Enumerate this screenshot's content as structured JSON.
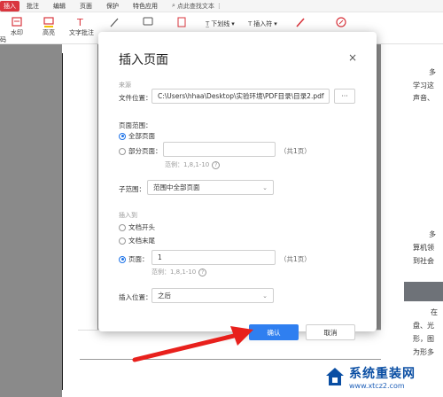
{
  "menubar": {
    "tabs": [
      "插入",
      "批注",
      "编辑",
      "页面",
      "保护",
      "特色应用"
    ],
    "search_label": "点此查找文本"
  },
  "ribbon": {
    "items": [
      "水印",
      "高亮",
      "文字批注",
      "下划线",
      "插入符"
    ],
    "left_partial": "码"
  },
  "dialog": {
    "title": "插入页面",
    "source_section": "来源",
    "file_location_label": "文件位置：",
    "file_path": "C:\\Users\\hhaa\\Desktop\\实验环境\\PDF目录\\目录2.pdf",
    "browse_label": "···",
    "page_range_section": "页面范围：",
    "all_pages_label": "全部页面",
    "partial_pages_label": "部分页面：",
    "partial_pages_value": "",
    "partial_total": "（共1页）",
    "partial_example": "范例：1,8,1-10",
    "sub_range_label": "子范围：",
    "sub_range_value": "范围中全部页面",
    "insert_to_section": "插入到",
    "doc_start_label": "文档开头",
    "doc_end_label": "文档末尾",
    "page_label": "页面：",
    "page_value": "1",
    "page_total": "（共1页）",
    "page_example": "范例：1,8,1-10",
    "insert_position_label": "插入位置：",
    "insert_position_value": "之后",
    "ok_label": "确认",
    "cancel_label": "取消",
    "help_glyph": "?",
    "close_glyph": "×"
  },
  "document_text": {
    "r1": "多",
    "r2": "学习这",
    "r3": "声音、",
    "r4": "多",
    "r5": "算机领",
    "r6": "到社会",
    "r7": "在",
    "r8": "盘、光",
    "r9": "形，图",
    "r10": "为形多"
  },
  "watermark": {
    "title": "系统重装网",
    "url": "www.xtcz2.com"
  },
  "colors": {
    "accent": "#2f7ff0",
    "menu_active": "#d9363e",
    "arrow": "#e8201c"
  }
}
